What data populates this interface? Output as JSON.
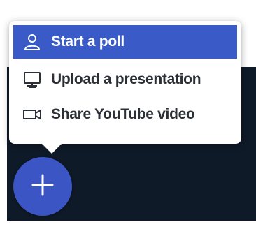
{
  "menu": {
    "items": [
      {
        "label": "Start a poll",
        "icon": "user-icon",
        "active": true
      },
      {
        "label": "Upload a presentation",
        "icon": "presentation-icon",
        "active": false
      },
      {
        "label": "Share YouTube video",
        "icon": "video-camera-icon",
        "active": false
      }
    ]
  },
  "fab": {
    "icon": "plus-icon"
  },
  "colors": {
    "accent": "#3a5bc7",
    "background_dark": "#0f1a28",
    "text": "#2b2f36"
  }
}
